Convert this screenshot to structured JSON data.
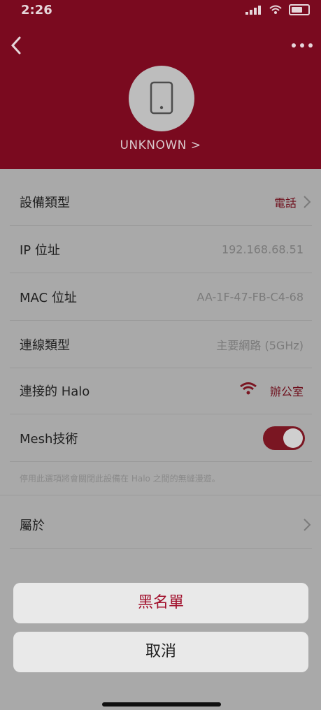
{
  "status_bar": {
    "time": "2:26"
  },
  "header": {
    "device_name": "UNKNOWN >",
    "accent_color": "#7a0a1f"
  },
  "details": {
    "device_type": {
      "label": "設備類型",
      "value": "電話"
    },
    "ip": {
      "label": "IP 位址",
      "value": "192.168.68.51"
    },
    "mac": {
      "label": "MAC 位址",
      "value": "AA-1F-47-FB-C4-68"
    },
    "connection": {
      "label": "連線類型",
      "value": "主要網路 (5GHz)"
    },
    "halo": {
      "label": "連接的 Halo",
      "value": "辦公室"
    },
    "mesh": {
      "label": "Mesh技術",
      "enabled": true
    },
    "note": "停用此選項將會關閉此設備在 Halo 之間的無縫漫遊。",
    "about": {
      "label": "屬於"
    }
  },
  "action_sheet": {
    "blacklist": "黑名單",
    "cancel": "取消"
  }
}
